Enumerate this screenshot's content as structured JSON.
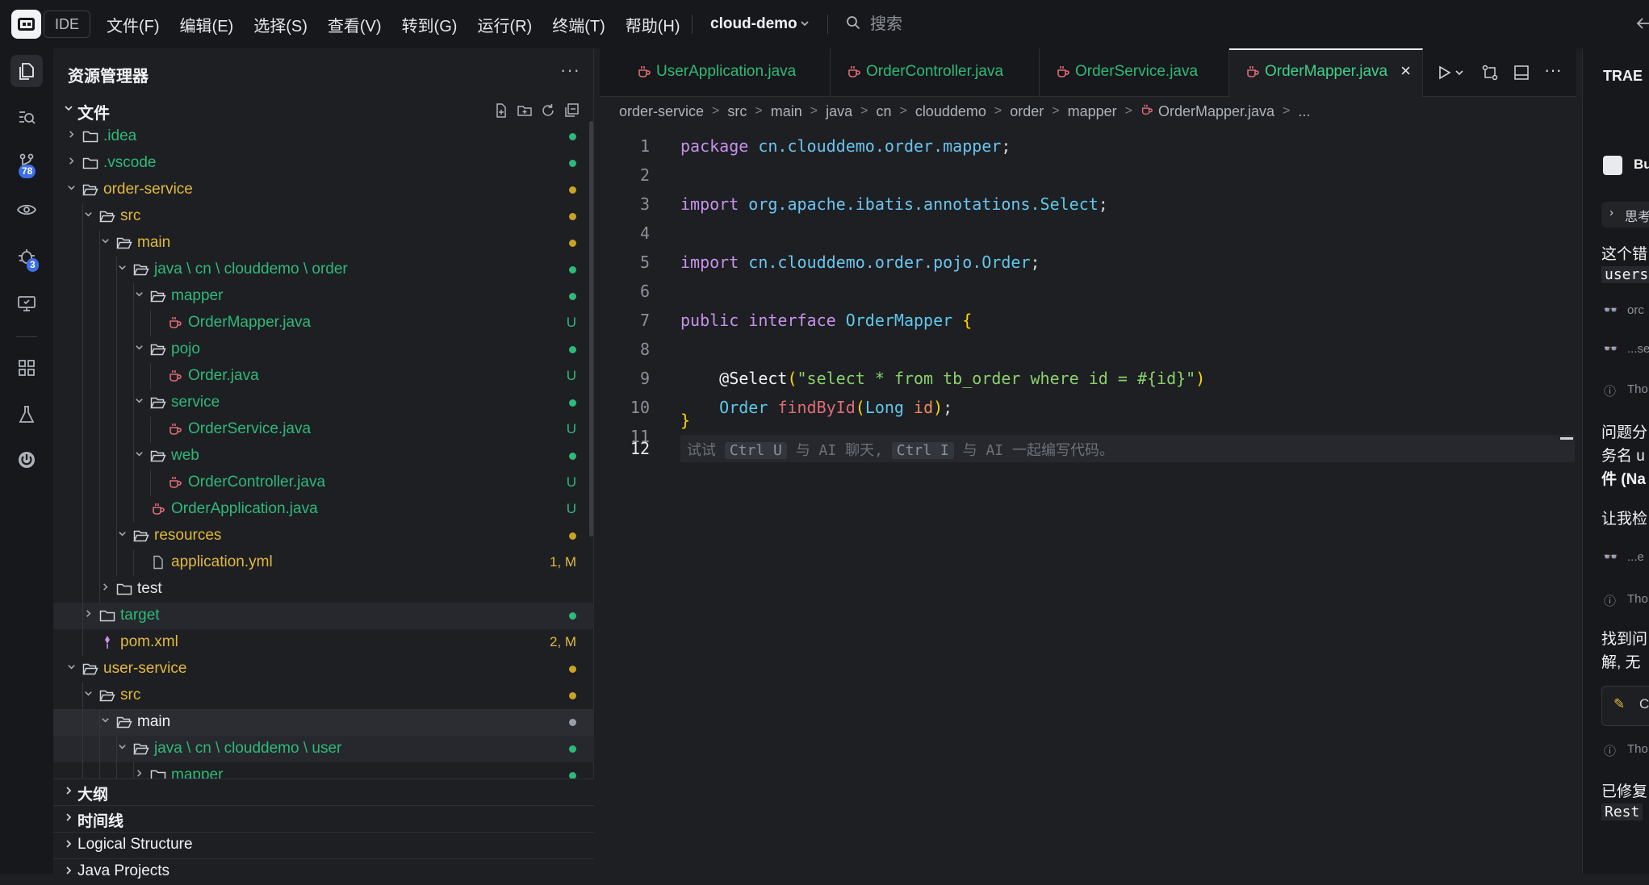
{
  "titlebar": {
    "ide_label": "IDE",
    "menu": [
      "文件(F)",
      "编辑(E)",
      "选择(S)",
      "查看(V)",
      "转到(G)",
      "运行(R)",
      "终端(T)",
      "帮助(H)"
    ],
    "project": "cloud-demo",
    "search_placeholder": "搜索"
  },
  "activity": {
    "scm_badge": "78",
    "debug_badge": "3"
  },
  "explorer": {
    "title": "资源管理器",
    "more": "···",
    "files_label": "文件",
    "tree": [
      {
        "name": "idea",
        "display": ".idea",
        "depth": 0,
        "chev": ">",
        "icon": "folder",
        "color": "#2fb979",
        "status": "",
        "dot": "#2fb979"
      },
      {
        "name": "vscode",
        "display": ".vscode",
        "depth": 0,
        "chev": ">",
        "icon": "folder",
        "color": "#2fb979",
        "status": "",
        "dot": "#2fb979"
      },
      {
        "name": "order-service",
        "display": "order-service",
        "depth": 0,
        "chev": "v",
        "icon": "folder-open",
        "color": "#e2b93b",
        "status": "",
        "dot": "#c9a227"
      },
      {
        "name": "src",
        "display": "src",
        "depth": 1,
        "chev": "v",
        "icon": "folder-open",
        "color": "#e2b93b",
        "status": "",
        "dot": "#c9a227"
      },
      {
        "name": "main",
        "display": "main",
        "depth": 2,
        "chev": "v",
        "icon": "folder-open",
        "color": "#e2b93b",
        "status": "",
        "dot": "#c9a227"
      },
      {
        "name": "java-pkg",
        "display": "java \\ cn \\ clouddemo \\ order",
        "depth": 3,
        "chev": "v",
        "icon": "folder-open",
        "color": "#2fb979",
        "status": "",
        "dot": "#2fb979"
      },
      {
        "name": "mapper",
        "display": "mapper",
        "depth": 4,
        "chev": "v",
        "icon": "folder-open",
        "color": "#2fb979",
        "status": "",
        "dot": "#2fb979"
      },
      {
        "name": "OrderMapper.java",
        "display": "OrderMapper.java",
        "depth": 5,
        "chev": "",
        "icon": "java",
        "color": "#2fb979",
        "status": "U",
        "dot": ""
      },
      {
        "name": "pojo",
        "display": "pojo",
        "depth": 4,
        "chev": "v",
        "icon": "folder-open",
        "color": "#2fb979",
        "status": "",
        "dot": "#2fb979"
      },
      {
        "name": "Order.java",
        "display": "Order.java",
        "depth": 5,
        "chev": "",
        "icon": "java",
        "color": "#2fb979",
        "status": "U",
        "dot": ""
      },
      {
        "name": "service",
        "display": "service",
        "depth": 4,
        "chev": "v",
        "icon": "folder-open",
        "color": "#2fb979",
        "status": "",
        "dot": "#2fb979"
      },
      {
        "name": "OrderService.java",
        "display": "OrderService.java",
        "depth": 5,
        "chev": "",
        "icon": "java",
        "color": "#2fb979",
        "status": "U",
        "dot": ""
      },
      {
        "name": "web",
        "display": "web",
        "depth": 4,
        "chev": "v",
        "icon": "folder-open",
        "color": "#2fb979",
        "status": "",
        "dot": "#2fb979"
      },
      {
        "name": "OrderController.java",
        "display": "OrderController.java",
        "depth": 5,
        "chev": "",
        "icon": "java",
        "color": "#2fb979",
        "status": "U",
        "dot": ""
      },
      {
        "name": "OrderApplication.java",
        "display": "OrderApplication.java",
        "depth": 4,
        "chev": "",
        "icon": "java",
        "color": "#2fb979",
        "status": "U",
        "dot": ""
      },
      {
        "name": "resources",
        "display": "resources",
        "depth": 3,
        "chev": "v",
        "icon": "folder-open",
        "color": "#e2b93b",
        "status": "",
        "dot": "#c9a227"
      },
      {
        "name": "application.yml",
        "display": "application.yml",
        "depth": 4,
        "chev": "",
        "icon": "file",
        "color": "#e2b93b",
        "status": "1, M",
        "dot": ""
      },
      {
        "name": "test",
        "display": "test",
        "depth": 2,
        "chev": ">",
        "icon": "folder",
        "color": "#e5e7eb",
        "status": "",
        "dot": ""
      },
      {
        "name": "target",
        "display": "target",
        "depth": 1,
        "chev": ">",
        "icon": "folder",
        "color": "#2fb979",
        "status": "",
        "dot": "#2fb979",
        "hl": true
      },
      {
        "name": "pom.xml",
        "display": "pom.xml",
        "depth": 1,
        "chev": "",
        "icon": "pom",
        "color": "#e2b93b",
        "status": "2, M",
        "dot": ""
      },
      {
        "name": "user-service",
        "display": "user-service",
        "depth": 0,
        "chev": "v",
        "icon": "folder-open",
        "color": "#e2b93b",
        "status": "",
        "dot": "#c9a227"
      },
      {
        "name": "user-src",
        "display": "src",
        "depth": 1,
        "chev": "v",
        "icon": "folder-open",
        "color": "#e2b93b",
        "status": "",
        "dot": "#c9a227"
      },
      {
        "name": "user-main",
        "display": "main",
        "depth": 2,
        "chev": "v",
        "icon": "folder-open",
        "color": "#f1f2f4",
        "status": "",
        "dot": "#9a9ea6",
        "sel": true
      },
      {
        "name": "user-java-pkg",
        "display": "java \\ cn \\ clouddemo \\ user",
        "depth": 3,
        "chev": "v",
        "icon": "folder-open",
        "color": "#2fb979",
        "status": "",
        "dot": "#2fb979",
        "hl": true
      },
      {
        "name": "user-mapper",
        "display": "mapper",
        "depth": 4,
        "chev": ">",
        "icon": "folder",
        "color": "#2fb979",
        "status": "",
        "dot": "#2fb979"
      }
    ],
    "sections": [
      "大纲",
      "时间线",
      "Logical Structure",
      "Java Projects"
    ]
  },
  "editor": {
    "tabs": [
      {
        "label": "UserApplication.java",
        "active": false
      },
      {
        "label": "OrderController.java",
        "active": false
      },
      {
        "label": "OrderService.java",
        "active": false
      },
      {
        "label": "OrderMapper.java",
        "active": true
      }
    ],
    "close": "×",
    "breadcrumb": [
      "order-service",
      "src",
      "main",
      "java",
      "cn",
      "clouddemo",
      "order",
      "mapper",
      "OrderMapper.java",
      "..."
    ],
    "breadcrumb_sep": ">",
    "line_numbers": [
      "1",
      "2",
      "3",
      "4",
      "5",
      "6",
      "7",
      "8",
      "9",
      "10",
      "11",
      "12"
    ],
    "code": {
      "l1_kw": "package",
      "l1_pkg": "cn.clouddemo.order.mapper",
      "semi": ";",
      "l3_kw": "import",
      "l3_pkg": "org.apache.ibatis.annotations.",
      "l3_cls": "Select",
      "l5_kw": "import",
      "l5_pkg": "cn.clouddemo.order.pojo.",
      "l5_cls": "Order",
      "l7_kw1": "public",
      "l7_kw2": "interface",
      "l7_name": "OrderMapper",
      "brace_open": "{",
      "l9_ann": "@Select",
      "l9_paren_open": "(",
      "l9_str": "\"select * from tb_order where id = #{id}\"",
      "l9_paren_close": ")",
      "l10_type": "Order",
      "l10_fn": "findById",
      "l10_ptype": "Long",
      "l10_param": "id",
      "brace_close": "}",
      "hint_prefix": "试试",
      "hint_key1": "Ctrl U",
      "hint_mid": "与 AI 聊天,",
      "hint_key2": "Ctrl I",
      "hint_suffix": "与 AI 一起编写代码。"
    }
  },
  "right_panel": {
    "title": "TRAE",
    "bu": "Bu",
    "think": "思考",
    "p1a": "这个错",
    "p1b": "users",
    "r1": "orc",
    "r2": "...se",
    "t1": "Tho",
    "p2a": "问题分",
    "p2b": "务名 u",
    "p2c": "件 (Na",
    "p3": "让我检",
    "r3": "...e",
    "t2": "Tho",
    "p4a": "找到问",
    "p4b": "解, 无",
    "code_btn": "C",
    "t3": "Tho",
    "p5a": "已修复",
    "p5b": "Rest"
  }
}
